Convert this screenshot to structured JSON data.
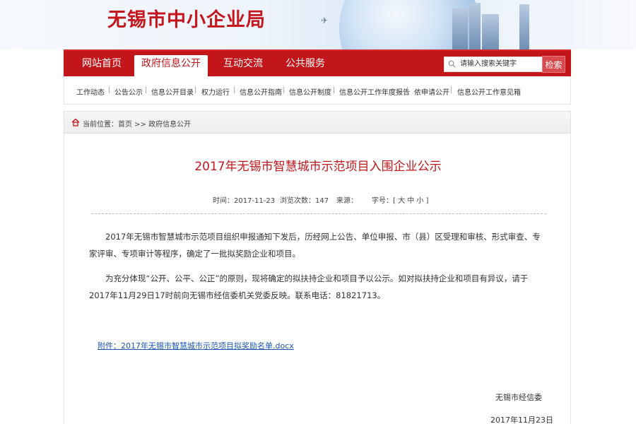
{
  "site": {
    "title": "无锡市中小企业局"
  },
  "nav": {
    "items": [
      {
        "label": "网站首页"
      },
      {
        "label": "政府信息公开"
      },
      {
        "label": "互动交流"
      },
      {
        "label": "公共服务"
      }
    ],
    "search_placeholder": "请输入搜索关键字",
    "search_button": "检索"
  },
  "subnav": {
    "items": [
      {
        "label": "工作动态"
      },
      {
        "label": "公告公示"
      },
      {
        "label": "信息公开目录"
      },
      {
        "label": "权力运行"
      },
      {
        "label": "信息公开指南"
      },
      {
        "label": "信息公开制度"
      },
      {
        "label": "信息公开工作年度报告"
      },
      {
        "label": "依申请公开"
      },
      {
        "label": "信息公开工作意见箱"
      }
    ],
    "separator": "|"
  },
  "breadcrumb": {
    "text": "当前位置：首页 >> 政府信息公开"
  },
  "article": {
    "title": "2017年无锡市智慧城市示范项目入围企业公示",
    "time": "时间：2017-11-23",
    "views": "浏览次数：147",
    "source": "来源：",
    "font_size": "字号：[ 大 中 小 ]",
    "para1": "2017年无锡市智慧城市示范项目组织申报通知下发后，历经网上公告、单位申报、市（县）区受理和审核、形式审查、专家评审、专项审计等程序，确定了一批拟奖励企业和项目。",
    "para2": "为充分体现“公开、公平、公正”的原则，现将确定的拟扶持企业和项目予以公示。如对拟扶持企业和项目有异议，请于2017年11月29日17时前向无锡市经信委机关党委反映。联系电话：81821713。",
    "attachment": "附件：2017年无锡市智慧城市示范项目拟奖励名单.docx",
    "signature_org": "无锡市经信委",
    "signature_date": "2017年11月23日"
  },
  "colors": {
    "brand_red": "#c3161b",
    "link_blue": "#1a56b5"
  }
}
